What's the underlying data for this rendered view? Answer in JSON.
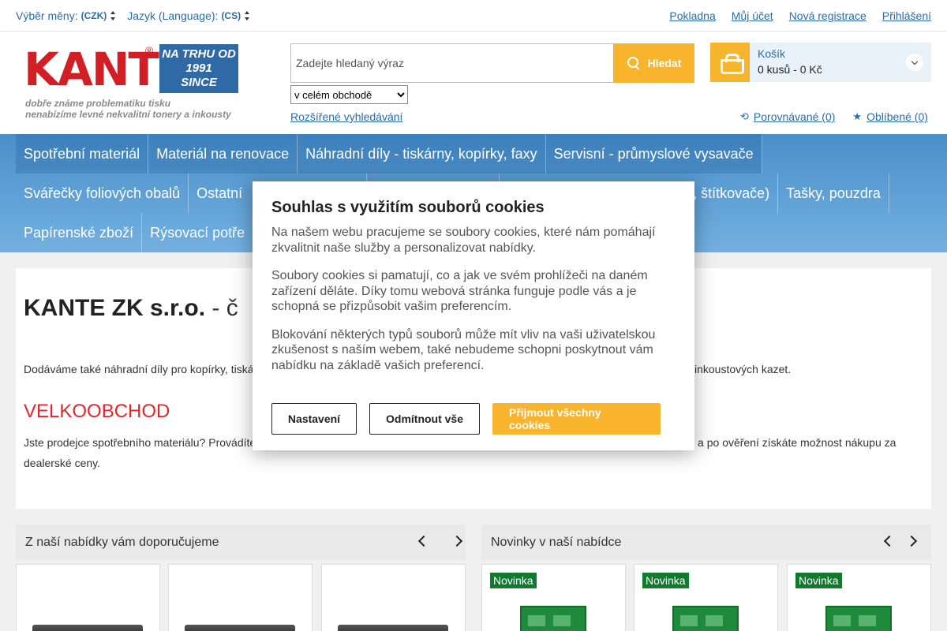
{
  "topbar": {
    "currency_label": "Výběr měny:",
    "currency_value": "(CZK)",
    "language_label": "Jazyk (Language):",
    "language_value": "(CS)",
    "links": [
      "Pokladna",
      "Můj účet",
      "Nová registrace",
      "Přihlášení"
    ]
  },
  "logo": {
    "brand": "KANTE",
    "reg": "®",
    "since_lines": [
      "NA TRHU OD",
      "1991",
      "SINCE"
    ],
    "tagline_1": "dobře známe problematiku tisku",
    "tagline_2": "nenabízíme levné nekvalitní tonery a inkousty"
  },
  "search": {
    "placeholder": "Zadejte hledaný výraz",
    "button_label": "Hledat",
    "scope_selected": "v celém obchodě",
    "advanced_link": "Rozšířené vyhledávání"
  },
  "cart": {
    "label": "Košík",
    "value": "0 kusů - 0 Kč"
  },
  "compare_link": "Porovnávané (0)",
  "favorites_link": "Oblíbené (0)",
  "nav": {
    "row1": [
      "Spotřební materiál",
      "Materiál na renovace",
      "Náhradní díly - tiskárny, kopírky, faxy",
      "Servisní - průmyslové vysavače"
    ],
    "row2_left": [
      "Svářečky foliových obalů",
      "Ostatní"
    ],
    "row2_right_fragment": "e, štítkovače)",
    "row2_last": "Tašky, pouzdra",
    "row3": [
      "Papírenské zboží",
      "Rýsovací potře"
    ]
  },
  "main": {
    "title_bold": "KANTE ZK s.r.o.",
    "title_rest": " - č",
    "para1_left": "Dodáváme také náhradní díly pro kopírky, tiská",
    "para1_right": "inkoustových kazet.",
    "wholesale_heading": "VELKOOBCHOD",
    "para2_left": "Jste prodejce spotřebního materiálu? Provádíte",
    "para2_right": " a po ověření získáte možnost nákupu za",
    "para2_line2": "dealerské ceny."
  },
  "carousels": {
    "recommended_title": "Z naší nabídky vám doporučujeme",
    "news_title": "Novinky v naší nabídce",
    "badge": "Novinka"
  },
  "cookie": {
    "title": "Souhlas s využitím souborů cookies",
    "p1": "Na našem webu pracujeme se soubory cookies, které nám pomáhají zkvalitnit naše služby a personalizovat nabídky.",
    "p2": "Soubory cookies si pamatují, co a jak ve svém prohlížeči na daném zařízení děláte. Díky tomu webová stránka funguje podle vás a je schopná se přizpůsobit vašim preferencím.",
    "p3": "Blokování některých typů souborů může mít vliv na vaši uživatelskou zkušenost s naším webem, také nebudeme schopni poskytnout vám nabídku na základě vašich preferencí.",
    "btn_settings": "Nastavení",
    "btn_reject": "Odmítnout vše",
    "btn_accept": "Přijmout všechny cookies"
  },
  "colors": {
    "accent_yellow": "#f7b42c",
    "link_blue": "#2a6ca8",
    "nav_blue": "#4b8fc9",
    "brand_red": "#d21f26",
    "badge_green": "#117a2e"
  }
}
